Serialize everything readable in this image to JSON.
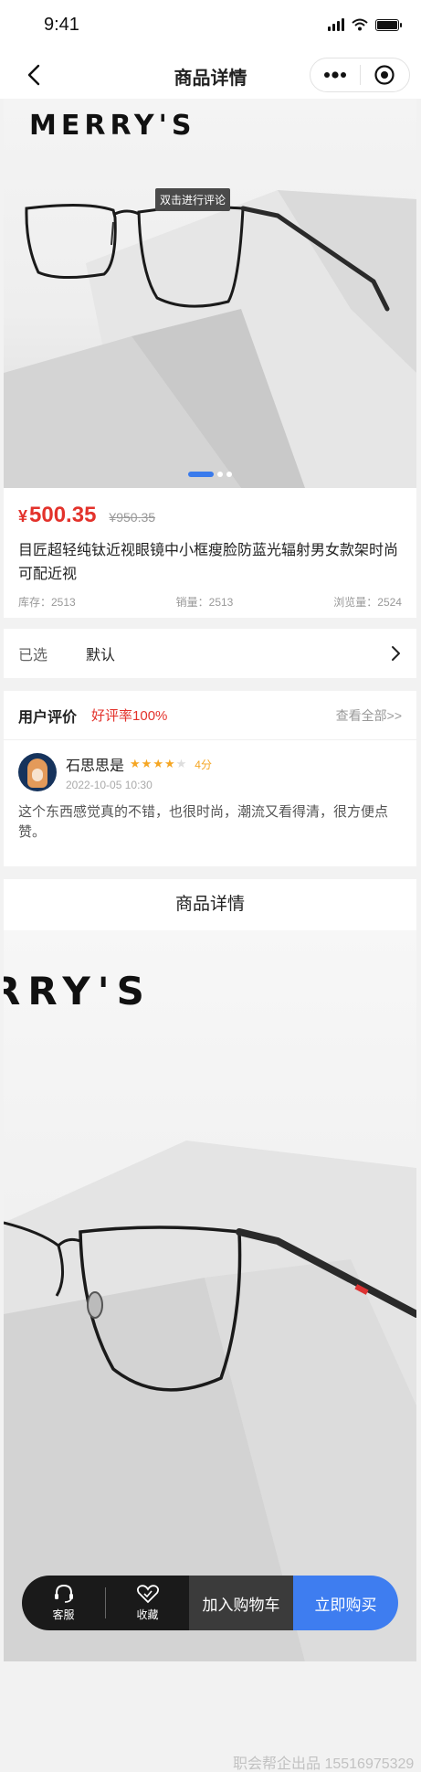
{
  "status": {
    "time": "9:41"
  },
  "nav": {
    "title": "商品详情"
  },
  "hero": {
    "brand_text": "MERRY'S",
    "tooltip": "双击进行评论",
    "slide_index": 1,
    "slide_count": 3
  },
  "product": {
    "currency": "¥",
    "price": "500.35",
    "original_price": "¥950.35",
    "title": "目匠超轻纯钛近视眼镜中小框瘦脸防蓝光辐射男女款架时尚可配近视",
    "stock": "库存：2513",
    "sales": "销量：2513",
    "views": "浏览量：2524"
  },
  "spec": {
    "label": "已选",
    "value": "默认"
  },
  "review": {
    "title": "用户评价",
    "rate": "好评率100%",
    "more": "查看全部>>",
    "user_name": "石思思是",
    "stars": 4,
    "stars_max": 5,
    "score": "4分",
    "date": "2022-10-05  10:30",
    "text": "这个东西感觉真的不错，也很时尚，潮流又看得清，很方便点赞。"
  },
  "detail": {
    "title": "商品详情",
    "brand_text": "RRY'S"
  },
  "bottom_bar": {
    "service_label": "客服",
    "favorite_label": "收藏",
    "cart_label": "加入购物车",
    "buy_label": "立即购买",
    "buy_color": "#3e7df0"
  },
  "watermark": "职会帮企出品 15516975329",
  "colors": {
    "price": "#e3322b",
    "accent": "#3a7bec",
    "star": "#f5a623"
  }
}
